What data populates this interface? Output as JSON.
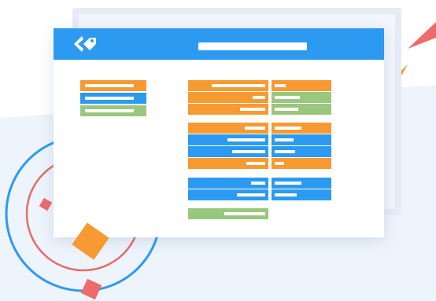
{
  "window": {
    "title": "",
    "logo_icon": "tag-icon"
  },
  "colors": {
    "orange": "#f79a32",
    "blue": "#2c9af0",
    "green": "#9ac77e",
    "titlebar": "#2c9af0",
    "accent_red": "#ee6b6b"
  },
  "legend": [
    {
      "color": "orange",
      "label": ""
    },
    {
      "color": "blue",
      "label": ""
    },
    {
      "color": "green",
      "label": ""
    }
  ],
  "groups": [
    {
      "rows": [
        {
          "left": "orange",
          "right": "orange"
        },
        {
          "left": "orange",
          "right": "green"
        },
        {
          "left": "orange",
          "right": "green"
        }
      ]
    },
    {
      "rows": [
        {
          "left": "orange",
          "right": "orange"
        },
        {
          "left": "blue",
          "right": "blue"
        },
        {
          "left": "blue",
          "right": "blue"
        },
        {
          "left": "orange",
          "right": "orange"
        }
      ]
    },
    {
      "rows": [
        {
          "left": "blue",
          "right": "blue"
        },
        {
          "left": "blue",
          "right": "blue"
        }
      ]
    },
    {
      "rows": [
        {
          "left": "green"
        }
      ]
    }
  ]
}
